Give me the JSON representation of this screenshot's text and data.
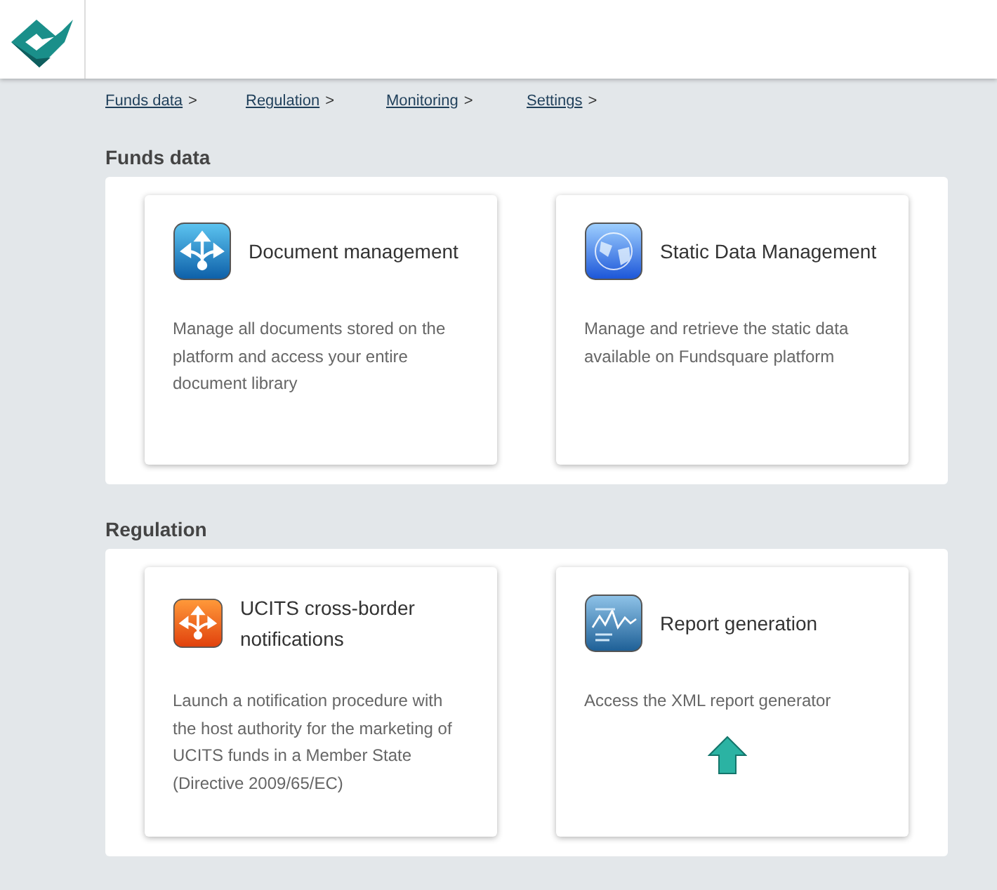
{
  "breadcrumbs": [
    {
      "label": "Funds data",
      "separator": ">"
    },
    {
      "label": "Regulation",
      "separator": ">"
    },
    {
      "label": "Monitoring",
      "separator": ">"
    },
    {
      "label": "Settings",
      "separator": ">"
    }
  ],
  "sections": [
    {
      "title": "Funds data",
      "cards": [
        {
          "kind": "document",
          "title": "Document management",
          "description": "Manage all documents stored on the platform and access your entire document library",
          "marked": false
        },
        {
          "kind": "globe",
          "title": "Static Data Management",
          "description": "Manage and retrieve the static data available on Fundsquare platform",
          "marked": false
        }
      ]
    },
    {
      "title": "Regulation",
      "cards": [
        {
          "kind": "notification",
          "title": "UCITS cross-border notifications",
          "description": "Launch a notification procedure with the host authority for the marketing of UCITS funds in a Member State (Directive 2009/65/EC)",
          "marked": false
        },
        {
          "kind": "report",
          "title": "Report generation",
          "description": "Access the XML report generator",
          "marked": true
        }
      ]
    }
  ]
}
